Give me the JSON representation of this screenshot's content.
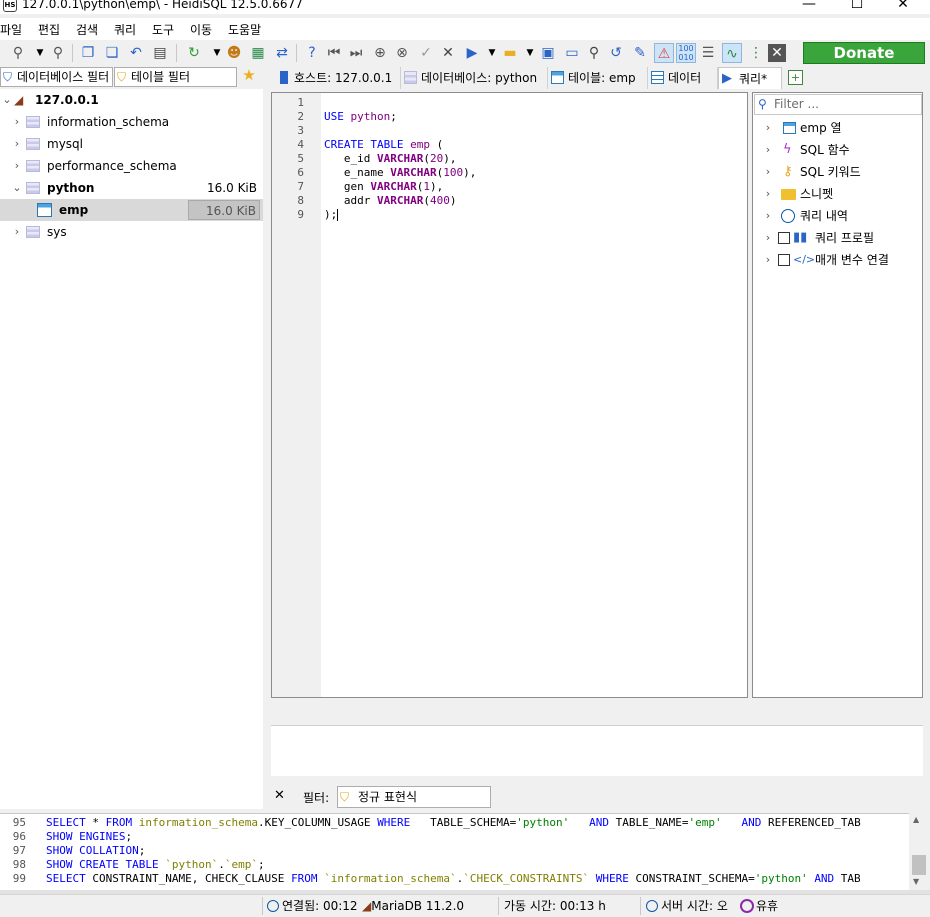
{
  "window": {
    "title": "127.0.0.1\\python\\emp\\ - HeidiSQL 12.5.0.6677",
    "minimize": "—",
    "maximize": "☐",
    "close": "✕"
  },
  "menu": [
    "파일",
    "편집",
    "검색",
    "쿼리",
    "도구",
    "이동",
    "도움말"
  ],
  "toolbar": {
    "donate_label": "Donate"
  },
  "left": {
    "db_filter": "데이터베이스 필터",
    "table_filter": "테이블 필터",
    "host": "127.0.0.1",
    "items": [
      {
        "label": "information_schema",
        "size": ""
      },
      {
        "label": "mysql",
        "size": ""
      },
      {
        "label": "performance_schema",
        "size": ""
      },
      {
        "label": "python",
        "size": "16.0 KiB"
      },
      {
        "label": "emp",
        "size": "16.0 KiB"
      },
      {
        "label": "sys",
        "size": ""
      }
    ]
  },
  "tabs": [
    {
      "label": "호스트: 127.0.0.1"
    },
    {
      "label": "데이터베이스: python"
    },
    {
      "label": "테이블: emp"
    },
    {
      "label": "데이터"
    },
    {
      "label": "쿼리*"
    }
  ],
  "editor": {
    "line_numbers": [
      "1",
      "2",
      "3",
      "4",
      "5",
      "6",
      "7",
      "8",
      "9"
    ],
    "lines": [
      "",
      "USE python;",
      "",
      "CREATE TABLE emp (",
      "   e_id VARCHAR(20),",
      "   e_name VARCHAR(100),",
      "   gen VARCHAR(1),",
      "   addr VARCHAR(400)",
      ");"
    ]
  },
  "helper": {
    "filter_placeholder": "Filter ...",
    "items": [
      "emp 열",
      "SQL 함수",
      "SQL 키워드",
      "스니펫",
      "쿼리 내역",
      "쿼리 프로필",
      "매개 변수 연결"
    ]
  },
  "filterbar": {
    "close": "✕",
    "label": "필터:",
    "value": "정규 표현식"
  },
  "sql_log": {
    "line_numbers": [
      "95",
      "96",
      "97",
      "98",
      "99"
    ],
    "lines": [
      "SELECT * FROM information_schema.KEY_COLUMN_USAGE WHERE   TABLE_SCHEMA='python'   AND TABLE_NAME='emp'   AND REFERENCED_TAB",
      "SHOW ENGINES;",
      "SHOW COLLATION;",
      "SHOW CREATE TABLE `python`.`emp`;",
      "SELECT CONSTRAINT_NAME, CHECK_CLAUSE FROM `information_schema`.`CHECK_CONSTRAINTS` WHERE CONSTRAINT_SCHEMA='python' AND TAB"
    ]
  },
  "status": {
    "connected": "연결됨: 00:12",
    "server": "MariaDB 11.2.0",
    "uptime": "가동 시간: 00:13 h",
    "server_time": "서버 시간: 오",
    "idle": "유휴"
  }
}
